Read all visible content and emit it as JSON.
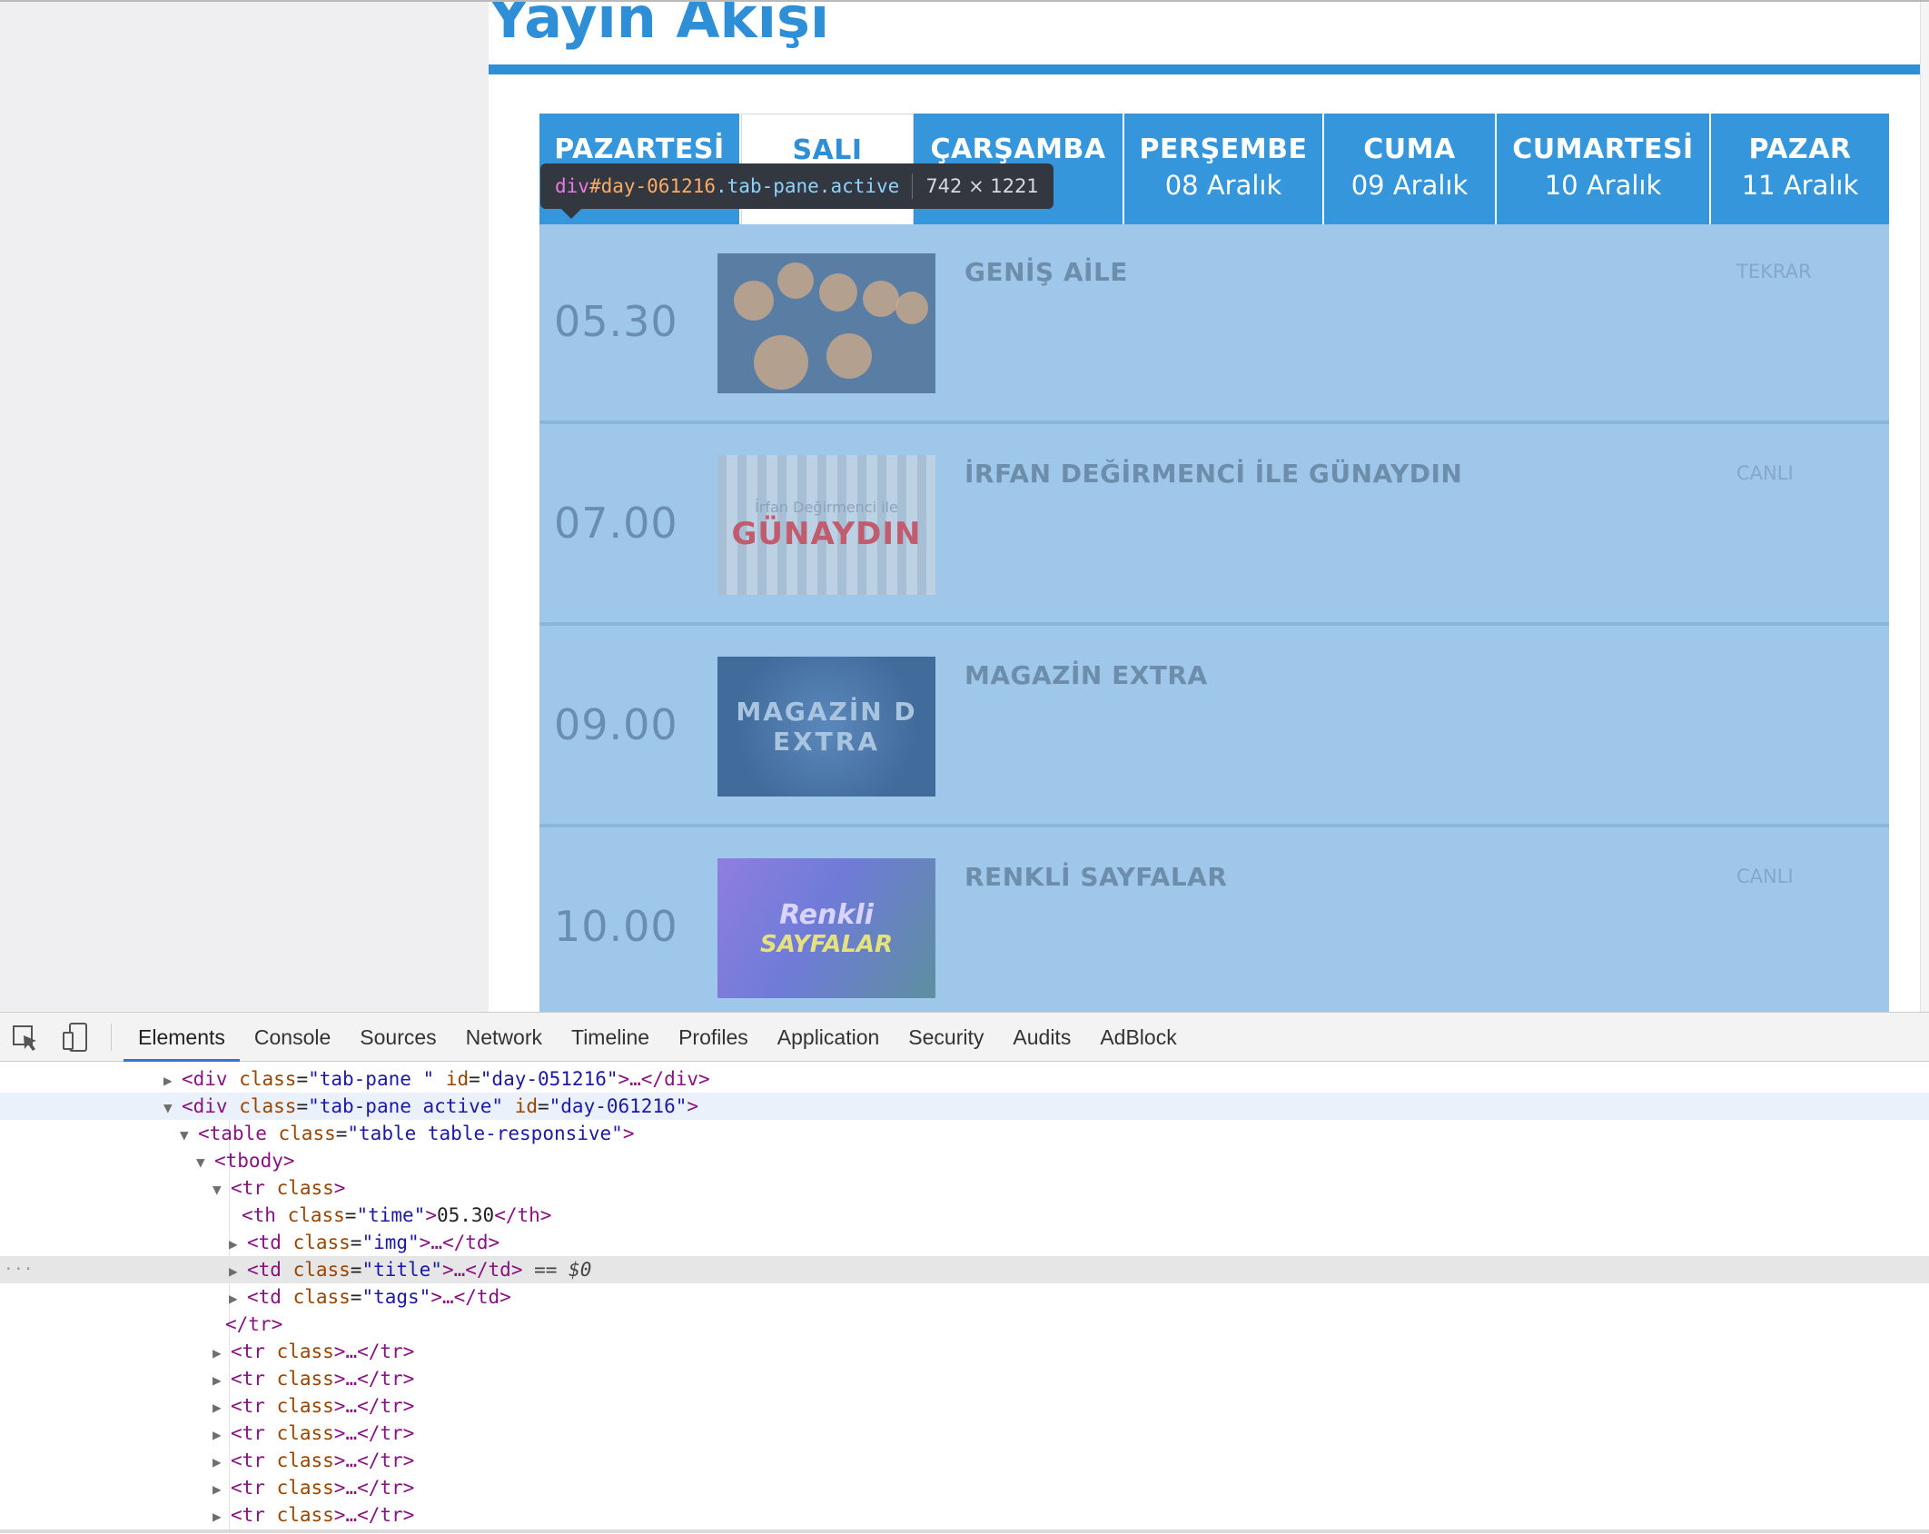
{
  "page": {
    "title": "Yayın Akışı"
  },
  "days": [
    {
      "day": "PAZARTESİ",
      "date": ""
    },
    {
      "day": "SALI",
      "date": ""
    },
    {
      "day": "ÇARŞAMBA",
      "date": "k"
    },
    {
      "day": "PERŞEMBE",
      "date": "08 Aralık"
    },
    {
      "day": "CUMA",
      "date": "09 Aralık"
    },
    {
      "day": "CUMARTESİ",
      "date": "10 Aralık"
    },
    {
      "day": "PAZAR",
      "date": "11 Aralık"
    }
  ],
  "active_day_index": 1,
  "schedule": [
    {
      "time": "05.30",
      "title": "GENİŞ AİLE",
      "tag": "TEKRAR",
      "thumb": "family-photo"
    },
    {
      "time": "07.00",
      "title": "İRFAN DEĞİRMENCİ İLE GÜNAYDIN",
      "tag": "CANLI",
      "thumb": "gunaydin-logo",
      "thumb_text_sub": "İrfan Değirmenci ile",
      "thumb_text_main": "GÜNAYDIN"
    },
    {
      "time": "09.00",
      "title": "MAGAZİN EXTRA",
      "tag": "",
      "thumb": "magazin-logo",
      "thumb_text_line1": "MAGAZİN D",
      "thumb_text_line2": "EXTRA"
    },
    {
      "time": "10.00",
      "title": "RENKLİ SAYFALAR",
      "tag": "CANLI",
      "thumb": "renkli-logo",
      "thumb_text_line1": "Renkli",
      "thumb_text_line2": "SAYFALAR"
    }
  ],
  "tooltip": {
    "tag": "div",
    "id": "#day-061216",
    "classes": ".tab-pane.active",
    "size": "742 × 1221"
  },
  "devtools": {
    "tabs": [
      "Elements",
      "Console",
      "Sources",
      "Network",
      "Timeline",
      "Profiles",
      "Application",
      "Security",
      "Audits",
      "AdBlock"
    ],
    "active_tab": "Elements",
    "icons": [
      "inspect-element-icon",
      "device-mode-icon"
    ],
    "selected_marker": "== $0",
    "dom_lines": [
      {
        "text_tag_open": "<div ",
        "attrs": [
          [
            "class",
            "\"tab-pane \""
          ],
          [
            "id",
            "\"day-051216\""
          ]
        ],
        "tail": ">…</div>",
        "arrow": "▶"
      },
      {
        "text_tag_open": "<div ",
        "attrs": [
          [
            "class",
            "\"tab-pane active\""
          ],
          [
            "id",
            "\"day-061216\""
          ]
        ],
        "tail": ">",
        "arrow": "▼"
      },
      {
        "text_tag_open": "<table ",
        "attrs": [
          [
            "class",
            "\"table table-responsive\""
          ]
        ],
        "tail": ">",
        "arrow": "▼"
      },
      {
        "text_tag_open": "<tbody",
        "attrs": [],
        "tail": ">",
        "arrow": "▼"
      },
      {
        "text_tag_open": "<tr ",
        "attrs": [
          [
            "class",
            ""
          ]
        ],
        "tail": ">",
        "arrow": "▼"
      },
      {
        "text_tag_open": "<th ",
        "attrs": [
          [
            "class",
            "\"time\""
          ]
        ],
        "tail": ">",
        "content": "05.30",
        "close": "</th>",
        "arrow": ""
      },
      {
        "text_tag_open": "<td ",
        "attrs": [
          [
            "class",
            "\"img\""
          ]
        ],
        "tail": ">…</td>",
        "arrow": "▶"
      },
      {
        "text_tag_open": "<td ",
        "attrs": [
          [
            "class",
            "\"title\""
          ]
        ],
        "tail": ">…</td>",
        "arrow": "▶"
      },
      {
        "text_tag_open": "<td ",
        "attrs": [
          [
            "class",
            "\"tags\""
          ]
        ],
        "tail": ">…</td>",
        "arrow": "▶"
      },
      {
        "text_tag_open": "</tr>",
        "attrs": [],
        "tail": "",
        "arrow": ""
      },
      {
        "text_tag_open": "<tr ",
        "attrs": [
          [
            "class",
            ""
          ]
        ],
        "tail": ">…</tr>",
        "arrow": "▶"
      },
      {
        "text_tag_open": "<tr ",
        "attrs": [
          [
            "class",
            ""
          ]
        ],
        "tail": ">…</tr>",
        "arrow": "▶"
      },
      {
        "text_tag_open": "<tr ",
        "attrs": [
          [
            "class",
            ""
          ]
        ],
        "tail": ">…</tr>",
        "arrow": "▶"
      },
      {
        "text_tag_open": "<tr ",
        "attrs": [
          [
            "class",
            ""
          ]
        ],
        "tail": ">…</tr>",
        "arrow": "▶"
      },
      {
        "text_tag_open": "<tr ",
        "attrs": [
          [
            "class",
            ""
          ]
        ],
        "tail": ">…</tr>",
        "arrow": "▶"
      },
      {
        "text_tag_open": "<tr ",
        "attrs": [
          [
            "class",
            ""
          ]
        ],
        "tail": ">…</tr>",
        "arrow": "▶"
      },
      {
        "text_tag_open": "<tr ",
        "attrs": [
          [
            "class",
            ""
          ]
        ],
        "tail": ">…</tr>",
        "arrow": "▶"
      }
    ],
    "selected_line_index": 7,
    "highlighted_line_index": 1
  },
  "colors": {
    "accent": "#2e8ed6",
    "tab_bg": "#3596dc",
    "overlay": "#9ec7ea",
    "tooltip_bg": "#333740"
  }
}
